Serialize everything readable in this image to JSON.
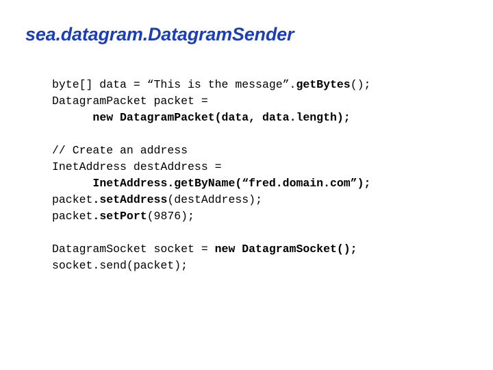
{
  "slide": {
    "title": "sea.datagram.DatagramSender",
    "title_color": "#1d3eb8",
    "background_color": "#ffffff",
    "code_color": "#000000",
    "code": {
      "lines": [
        {
          "id": "line-1",
          "segments": [
            {
              "text": "byte[] data = “This is the message”.",
              "bold": false
            },
            {
              "text": "getBytes",
              "bold": true
            },
            {
              "text": "();",
              "bold": false
            }
          ]
        },
        {
          "id": "line-2",
          "segments": [
            {
              "text": "DatagramPacket packet =",
              "bold": false
            }
          ]
        },
        {
          "id": "line-3",
          "segments": [
            {
              "text": "      ",
              "bold": false
            },
            {
              "text": "new DatagramPacket(data, data.length);",
              "bold": true
            }
          ]
        },
        {
          "id": "line-4-blank",
          "segments": []
        },
        {
          "id": "line-5",
          "segments": [
            {
              "text": "// Create an address",
              "bold": false
            }
          ]
        },
        {
          "id": "line-6",
          "segments": [
            {
              "text": "InetAddress destAddress =",
              "bold": false
            }
          ]
        },
        {
          "id": "line-7",
          "segments": [
            {
              "text": "      ",
              "bold": false
            },
            {
              "text": "InetAddress.getByName(“fred.domain.com”);",
              "bold": true
            }
          ]
        },
        {
          "id": "line-8",
          "segments": [
            {
              "text": "packet",
              "bold": false
            },
            {
              "text": ".setAddress",
              "bold": true
            },
            {
              "text": "(destAddress);",
              "bold": false
            }
          ]
        },
        {
          "id": "line-9",
          "segments": [
            {
              "text": "packet",
              "bold": false
            },
            {
              "text": ".setPort",
              "bold": true
            },
            {
              "text": "(9876);",
              "bold": false
            }
          ]
        },
        {
          "id": "line-10-blank",
          "segments": []
        },
        {
          "id": "line-11",
          "segments": [
            {
              "text": "DatagramSocket socket = ",
              "bold": false
            },
            {
              "text": "new DatagramSocket();",
              "bold": true
            }
          ]
        },
        {
          "id": "line-12",
          "segments": [
            {
              "text": "socket.send(packet);",
              "bold": false
            }
          ]
        }
      ]
    }
  }
}
